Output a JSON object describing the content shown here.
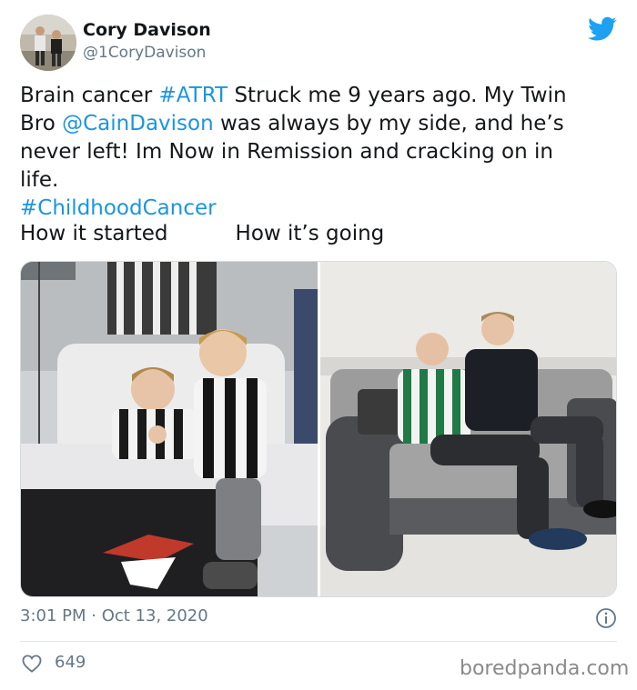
{
  "author": {
    "name": "Cory Davison",
    "handle": "@1CoryDavison"
  },
  "tweet": {
    "line1_a": "Brain cancer ",
    "line1_tag": "#ATRT",
    "line1_b": " Struck me 9 years ago. My Twin",
    "line2_a": "Bro ",
    "line2_mention": "@CainDavison",
    "line2_b": " was always by my side, and he’s",
    "line3": "never left! Im Now in Remission and cracking on in",
    "line4": "life.",
    "hashtag": "#ChildhoodCancer",
    "caption_left": "How it started",
    "caption_right": "How it’s going"
  },
  "media": {
    "left_photo": "hospital-bed-photo",
    "right_photo": "sofa-photo"
  },
  "meta": {
    "timestamp": "3:01 PM · Oct 13, 2020"
  },
  "engagement": {
    "likes": "649"
  },
  "watermark": "boredpanda.com",
  "colors": {
    "link": "#1b95e0",
    "twitter_blue": "#1da1f2",
    "muted": "#657786"
  },
  "icons": [
    "twitter-bird-icon",
    "info-icon",
    "heart-icon"
  ]
}
